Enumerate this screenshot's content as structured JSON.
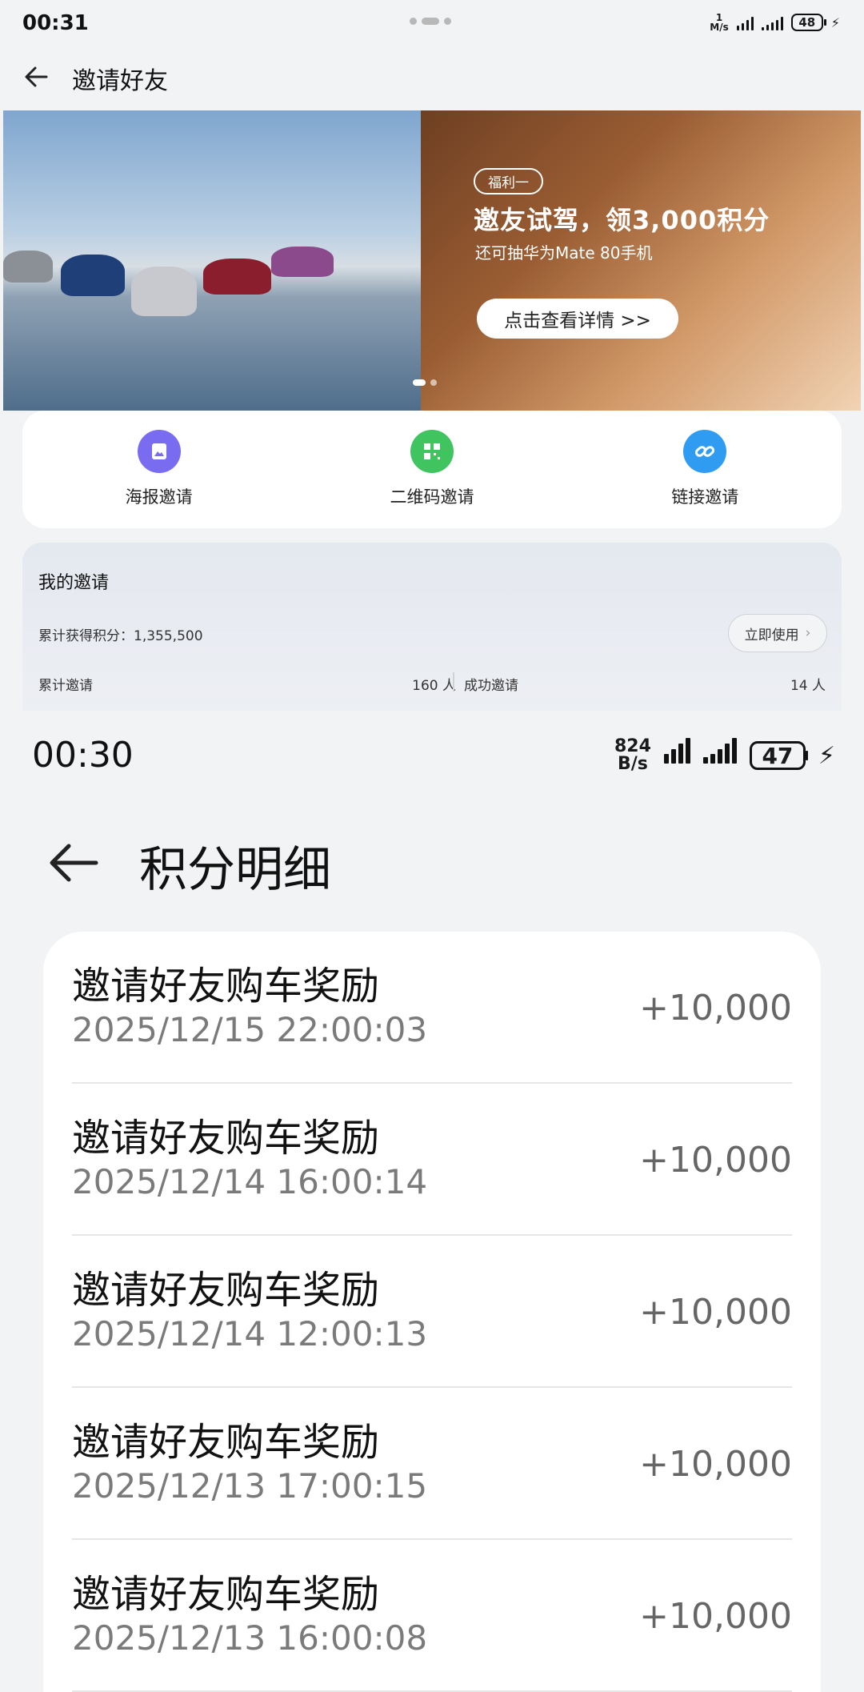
{
  "top": {
    "status_bar": {
      "time": "00:31",
      "speed_top": "1",
      "speed_unit": "M/s",
      "battery": "48"
    },
    "title": "邀请好友",
    "banner": {
      "tag": "福利一",
      "headline": "邀友试驾，领3,000积分",
      "subline": "还可抽华为Mate 80手机",
      "button": "点击查看详情 >>"
    },
    "invite_options": [
      {
        "label": "海报邀请",
        "icon": "poster-icon",
        "color": "#7a6cf0"
      },
      {
        "label": "二维码邀请",
        "icon": "qrcode-icon",
        "color": "#3fc460"
      },
      {
        "label": "链接邀请",
        "icon": "link-icon",
        "color": "#2f9cf2"
      }
    ],
    "my_invite": {
      "heading": "我的邀请",
      "points_label": "累计获得积分：",
      "points_value": "1,355,500",
      "use_button": "立即使用",
      "total_label": "累计邀请",
      "total_value": "160 人",
      "success_label": "成功邀请",
      "success_value": "14 人"
    }
  },
  "bottom": {
    "status_bar": {
      "time": "00:30",
      "speed_value": "824",
      "speed_unit": "B/s",
      "battery": "47"
    },
    "title": "积分明细",
    "records": [
      {
        "title": "邀请好友购车奖励",
        "datetime": "2025/12/15 22:00:03",
        "amount": "+10,000"
      },
      {
        "title": "邀请好友购车奖励",
        "datetime": "2025/12/14 16:00:14",
        "amount": "+10,000"
      },
      {
        "title": "邀请好友购车奖励",
        "datetime": "2025/12/14 12:00:13",
        "amount": "+10,000"
      },
      {
        "title": "邀请好友购车奖励",
        "datetime": "2025/12/13 17:00:15",
        "amount": "+10,000"
      },
      {
        "title": "邀请好友购车奖励",
        "datetime": "2025/12/13 16:00:08",
        "amount": "+10,000"
      }
    ]
  }
}
